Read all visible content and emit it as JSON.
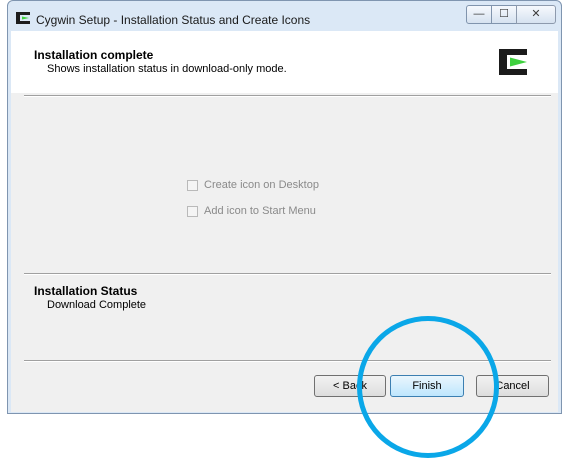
{
  "window": {
    "title": "Cygwin Setup - Installation Status and Create Icons"
  },
  "titlebar_controls": {
    "minimize": "—",
    "maximize": "☐",
    "close": "✕"
  },
  "header": {
    "title": "Installation complete",
    "subtitle": "Shows installation status in download-only mode."
  },
  "options": {
    "desktop_icon_label": "Create icon on Desktop",
    "start_menu_label": "Add icon to Start Menu",
    "desktop_icon_checked": false,
    "start_menu_checked": false
  },
  "status": {
    "title": "Installation Status",
    "text": "Download Complete"
  },
  "buttons": {
    "back": "< Back",
    "finish": "Finish",
    "cancel": "Cancel"
  },
  "colors": {
    "highlight_circle": "#0aa7e8",
    "cygwin_green": "#3fd13f"
  }
}
